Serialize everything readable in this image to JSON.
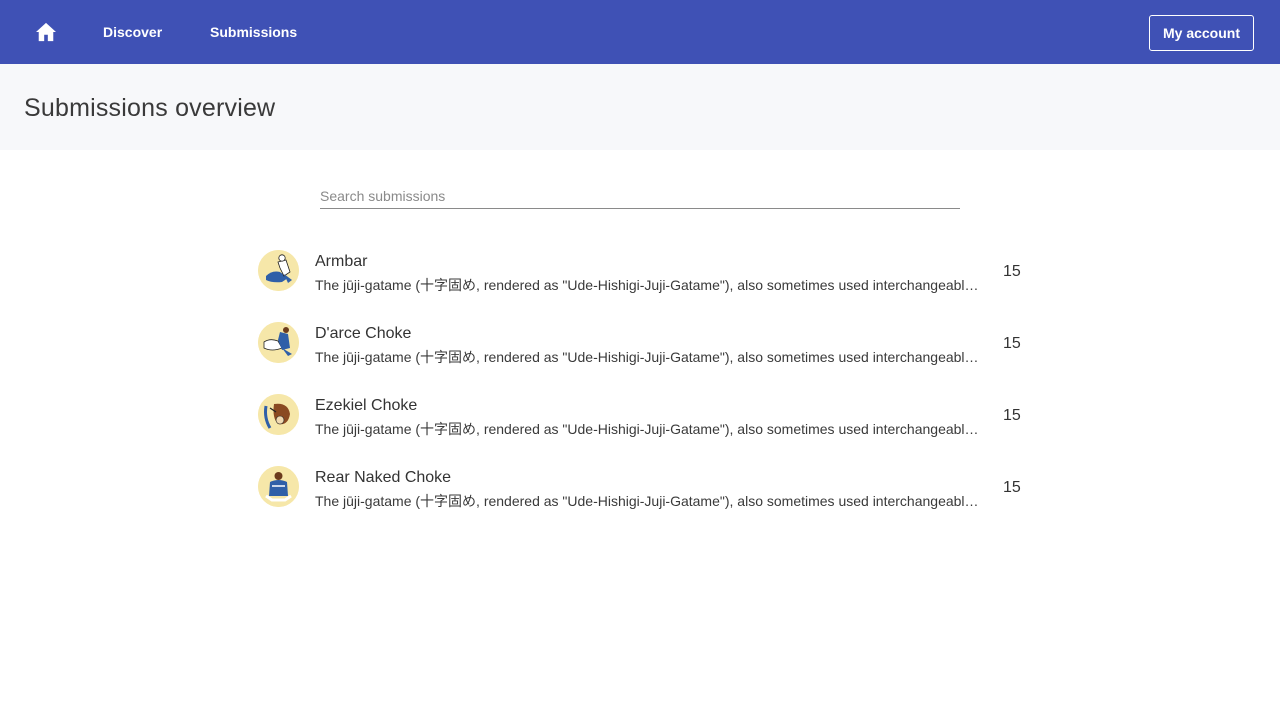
{
  "nav": {
    "home_icon": "home-icon",
    "discover_label": "Discover",
    "submissions_label": "Submissions",
    "account_label": "My account",
    "bar_color": "#3f51b5"
  },
  "header": {
    "title": "Submissions overview"
  },
  "search": {
    "placeholder": "Search submissions",
    "value": ""
  },
  "submissions": [
    {
      "name": "Armbar",
      "description": "The jūji-gatame (十字固め, rendered as \"Ude-Hishigi-Juji-Gatame\"), also sometimes used interchangeably with the term armbar",
      "count": "15"
    },
    {
      "name": "D'arce Choke",
      "description": "The jūji-gatame (十字固め, rendered as \"Ude-Hishigi-Juji-Gatame\"), also sometimes used interchangeably with the term armbar",
      "count": "15"
    },
    {
      "name": "Ezekiel Choke",
      "description": "The jūji-gatame (十字固め, rendered as \"Ude-Hishigi-Juji-Gatame\"), also sometimes used interchangeably with the term armbar",
      "count": "15"
    },
    {
      "name": "Rear Naked Choke",
      "description": "The jūji-gatame (十字固め, rendered as \"Ude-Hishigi-Juji-Gatame\"), also sometimes used interchangeably with the term armbar",
      "count": "15"
    }
  ]
}
